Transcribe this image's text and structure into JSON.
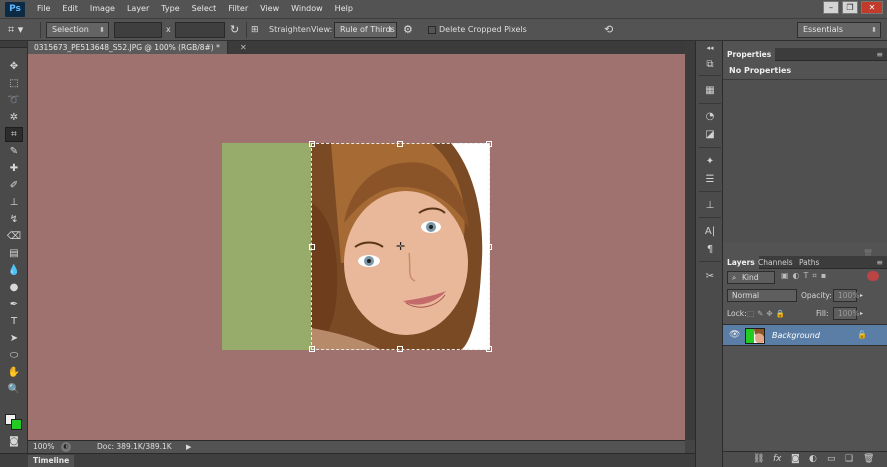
{
  "app": {
    "logo": "Ps",
    "menu": [
      "File",
      "Edit",
      "Image",
      "Layer",
      "Type",
      "Select",
      "Filter",
      "View",
      "Window",
      "Help"
    ],
    "menu_underline": [
      "F",
      "E",
      "I",
      "L",
      "y",
      "S",
      "T",
      "V",
      "W",
      "H"
    ]
  },
  "options": {
    "preset": "Selection",
    "ratio_separator": "x",
    "straighten": "Straighten",
    "view_label": "View:",
    "view_value": "Rule of Thirds",
    "delete_cropped": "Delete Cropped Pixels",
    "workspace": "Essentials"
  },
  "document": {
    "tab_title": "0315673_PE513648_S52.JPG @ 100% (RGB/8#) *",
    "zoom": "100%",
    "doc_size": "Doc: 389.1K/389.1K"
  },
  "timeline": {
    "label": "Timeline"
  },
  "properties": {
    "tab": "Properties",
    "title": "No Properties"
  },
  "layers": {
    "tabs": [
      "Layers",
      "Channels",
      "Paths"
    ],
    "kind": "Kind",
    "blend_mode": "Normal",
    "opacity_label": "Opacity:",
    "opacity_value": "100%",
    "lock_label": "Lock:",
    "fill_label": "Fill:",
    "fill_value": "100%",
    "layer_name": "Background"
  },
  "colors": {
    "canvas": "#9f7270",
    "green_area": "#97ab6a",
    "fg": "#f0f0f0",
    "bg": "#22cc22",
    "selected_layer": "#5b7ea6"
  }
}
